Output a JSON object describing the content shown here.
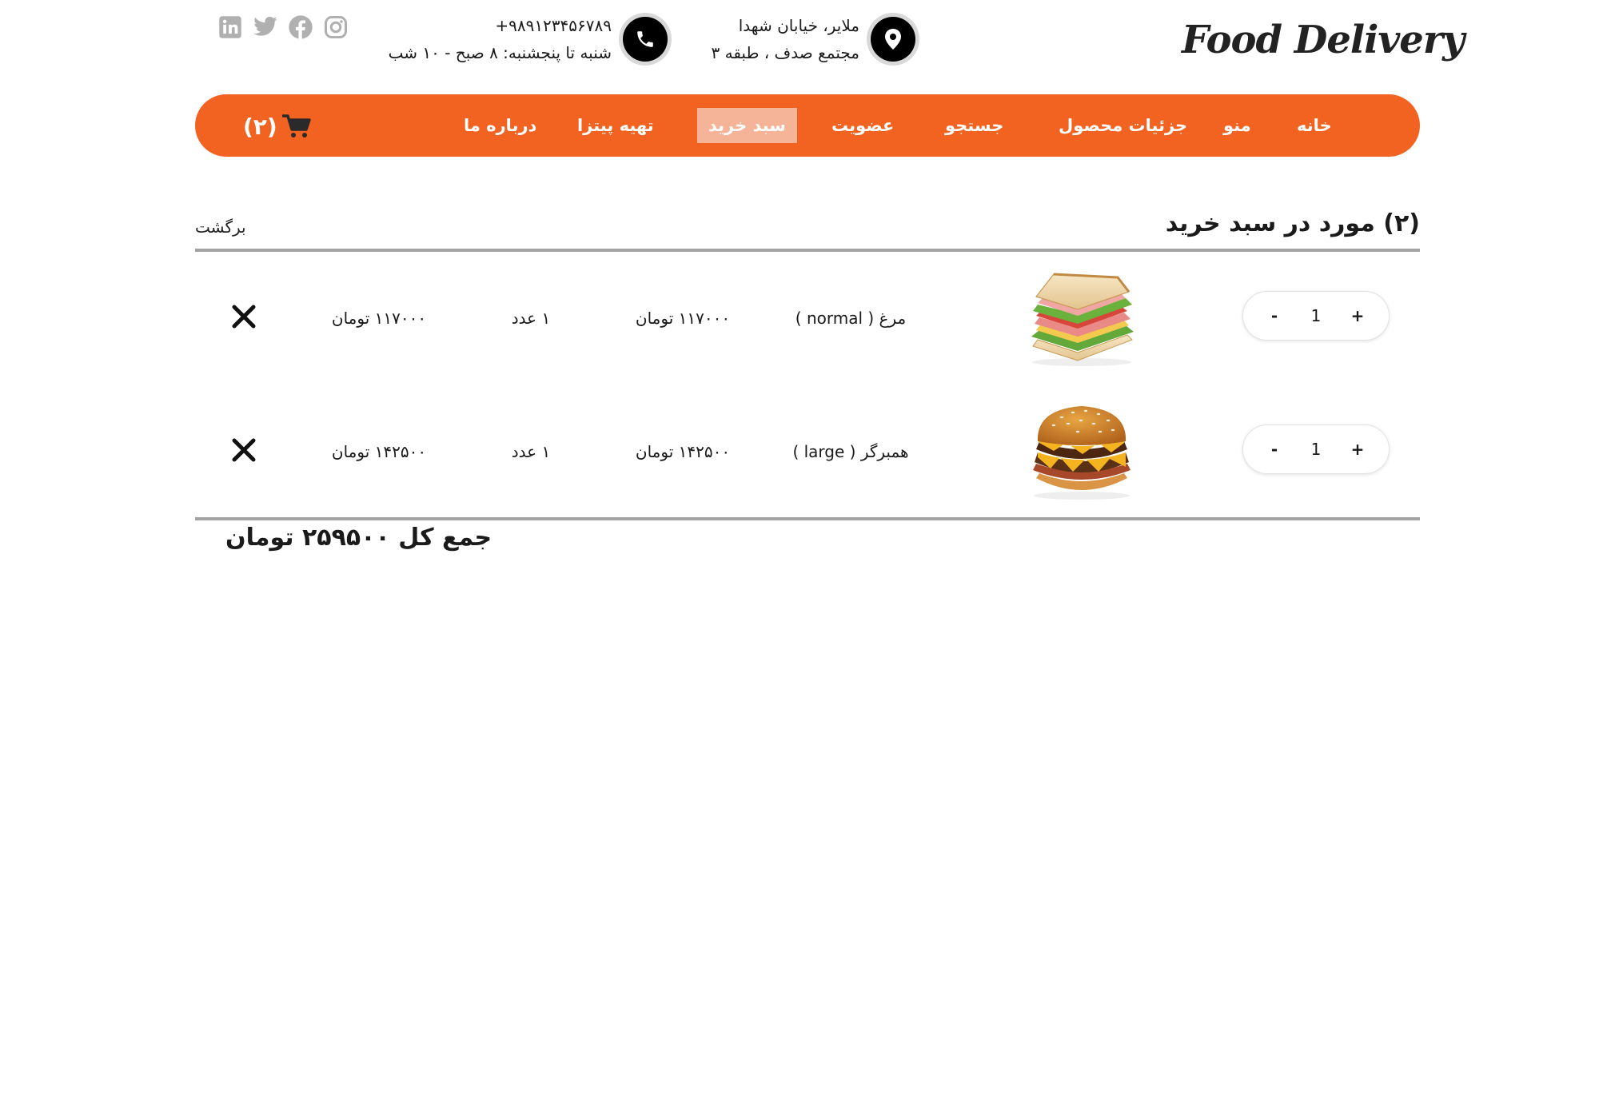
{
  "brand": {
    "name": "Food Delivery"
  },
  "contact": {
    "address_line1": "ملایر، خیابان شهدا",
    "address_line2": "مجتمع صدف ، طبقه ۳",
    "phone": "+۹۸۹۱۲۳۴۵۶۷۸۹",
    "hours": "شنبه تا پنجشنبه: ۸ صبح - ۱۰ شب"
  },
  "socials": [
    "instagram-icon",
    "facebook-icon",
    "twitter-icon",
    "linkedin-icon"
  ],
  "nav": {
    "items": [
      {
        "label": "خانه"
      },
      {
        "label": "منو"
      },
      {
        "label": "جزئیات محصول"
      },
      {
        "label": "جستجو"
      },
      {
        "label": "عضویت"
      },
      {
        "label": "سبد خرید",
        "active": true
      },
      {
        "label": "تهیه پیتزا"
      },
      {
        "label": "درباره ما"
      }
    ],
    "cart_count": "(۲)"
  },
  "cart": {
    "title": "(۲) مورد در سبد خرید",
    "back_label": "برگشت",
    "items": [
      {
        "name": "مرغ ( normal )",
        "unit_price": "۱۱۷۰۰۰ تومان",
        "qty_text": "۱ عدد",
        "total": "۱۱۷۰۰۰ تومان",
        "stepper_value": "1",
        "minus": "-",
        "plus": "+",
        "image": "sandwich"
      },
      {
        "name": "همبرگر ( large )",
        "unit_price": "۱۴۲۵۰۰ تومان",
        "qty_text": "۱ عدد",
        "total": "۱۴۲۵۰۰ تومان",
        "stepper_value": "1",
        "minus": "-",
        "plus": "+",
        "image": "burger"
      }
    ],
    "grand_total": "جمع کل ۲۵۹۵۰۰ تومان"
  },
  "colors": {
    "accent": "#f26322",
    "active_tab": "#f5b397",
    "divider": "#a3a3a3",
    "social": "#b0b0b0"
  }
}
